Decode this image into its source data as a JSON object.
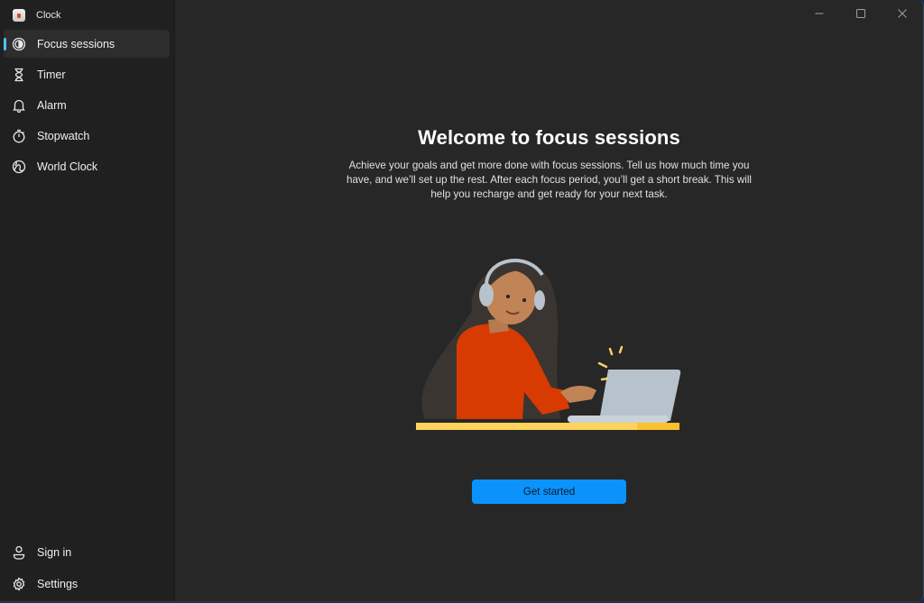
{
  "app": {
    "title": "Clock"
  },
  "sidebar": {
    "items": [
      {
        "label": "Focus sessions",
        "icon": "focus-icon",
        "active": true
      },
      {
        "label": "Timer",
        "icon": "hourglass-icon",
        "active": false
      },
      {
        "label": "Alarm",
        "icon": "bell-icon",
        "active": false
      },
      {
        "label": "Stopwatch",
        "icon": "stopwatch-icon",
        "active": false
      },
      {
        "label": "World Clock",
        "icon": "globe-icon",
        "active": false
      }
    ],
    "footer": [
      {
        "label": "Sign in",
        "icon": "person-icon"
      },
      {
        "label": "Settings",
        "icon": "gear-icon"
      }
    ]
  },
  "window_controls": {
    "minimize": "minimize-icon",
    "maximize": "maximize-icon",
    "close": "close-icon"
  },
  "main": {
    "title": "Welcome to focus sessions",
    "description": "Achieve your goals and get more done with focus sessions. Tell us how much time you have, and we’ll set up the rest. After each focus period, you’ll get a short break. This will help you recharge and get ready for your next task.",
    "cta_label": "Get started",
    "illustration": "person-with-headphones-at-laptop"
  },
  "colors": {
    "accent": "#0a93fb",
    "indicator": "#4cc2ff",
    "sidebar_bg": "#202020",
    "content_bg": "#272727"
  }
}
